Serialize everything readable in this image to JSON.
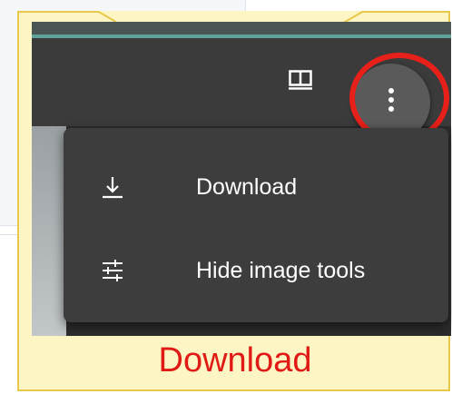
{
  "menu": {
    "items": [
      {
        "label": "Download",
        "icon": "download-icon"
      },
      {
        "label": "Hide image tools",
        "icon": "tune-icon"
      }
    ]
  },
  "toolbar": {
    "split_view_icon": "split-view-icon",
    "more_icon": "more-vert-icon"
  },
  "annotation": {
    "caption": "Download",
    "highlight_color": "#e8201a",
    "callout_color": "#fdf5c4"
  }
}
